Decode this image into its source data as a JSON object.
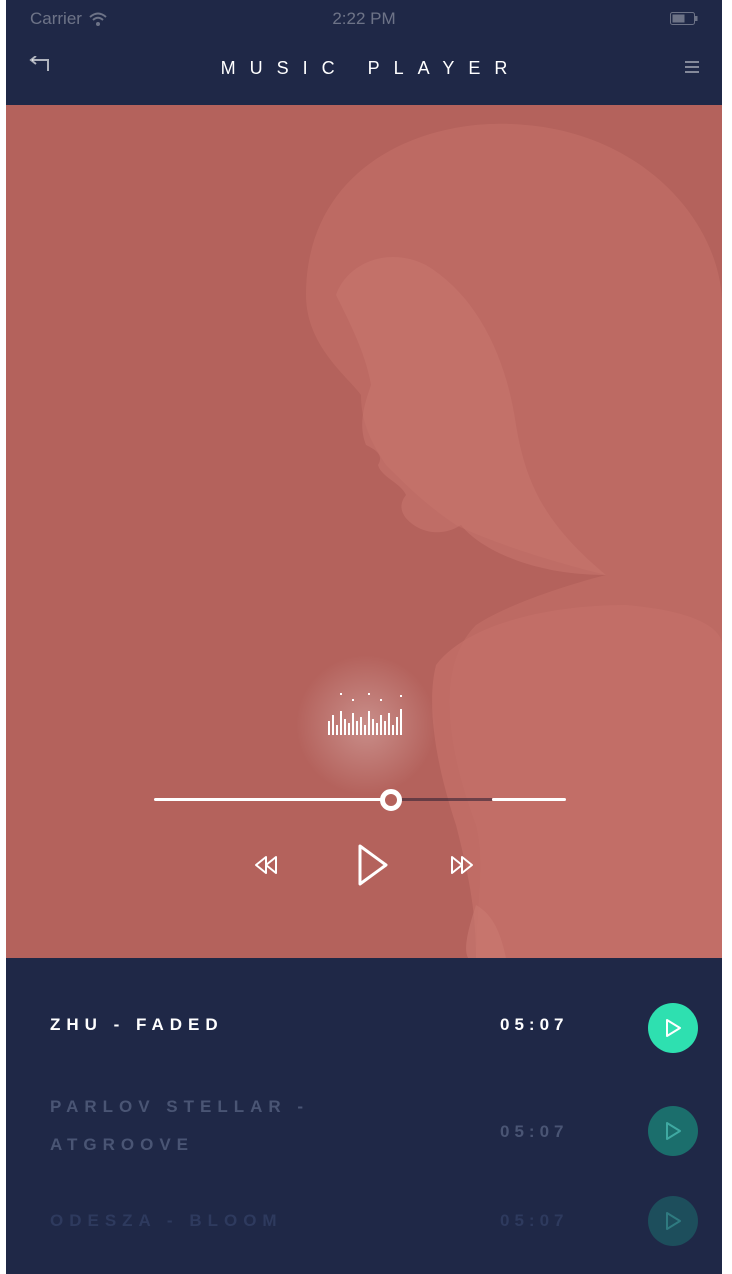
{
  "status_bar": {
    "carrier": "Carrier",
    "time": "2:22 PM",
    "wifi_icon": "wifi-icon",
    "battery_icon": "battery-icon"
  },
  "nav": {
    "title": "MUSIC PLAYER",
    "back_icon": "back-arrow-icon",
    "menu_icon": "hamburger-menu-icon"
  },
  "player": {
    "progress": 0.576,
    "buffered": 0.82,
    "controls": [
      "rewind-icon",
      "play-icon",
      "fast-forward-icon"
    ],
    "artwork_color": "#b4625c"
  },
  "playlist": [
    {
      "title": "ZHU - FADED",
      "duration": "05:07",
      "state": "active"
    },
    {
      "title": "PARLOV STELLAR - ATGROOVE",
      "duration": "05:07",
      "state": "inactive"
    },
    {
      "title": "ODESZA - BLOOM",
      "duration": "05:07",
      "state": "inactive"
    }
  ],
  "colors": {
    "background": "#1f2847",
    "accent": "#2ee0b0",
    "artwork": "#b4625c"
  }
}
